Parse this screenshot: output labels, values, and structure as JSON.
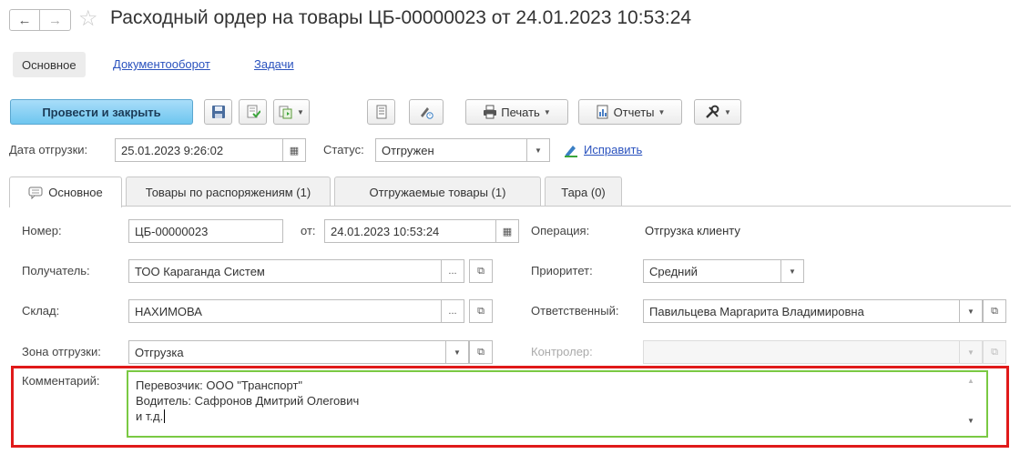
{
  "header": {
    "back_glyph": "←",
    "forward_glyph": "→",
    "star_glyph": "☆",
    "title": "Расходный ордер на товары ЦБ-00000023 от 24.01.2023 10:53:24"
  },
  "top_tabs": {
    "main": "Основное",
    "docflow": "Документооборот",
    "tasks": "Задачи"
  },
  "toolbar": {
    "post_close": "Провести и закрыть",
    "print": "Печать",
    "reports": "Отчеты",
    "caret": "▼"
  },
  "shipment": {
    "date_label": "Дата отгрузки:",
    "date_value": "25.01.2023  9:26:02",
    "status_label": "Статус:",
    "status_value": "Отгружен",
    "fix_link": "Исправить"
  },
  "inner_tabs": [
    {
      "label": "Основное"
    },
    {
      "label": "Товары по распоряжениям (1)"
    },
    {
      "label": "Отгружаемые товары (1)"
    },
    {
      "label": "Тара (0)"
    }
  ],
  "form": {
    "number_label": "Номер:",
    "number_value": "ЦБ-00000023",
    "from_label": "от:",
    "from_value": "24.01.2023 10:53:24",
    "operation_label": "Операция:",
    "operation_value": "Отгрузка клиенту",
    "recipient_label": "Получатель:",
    "recipient_value": "ТОО Караганда Систем",
    "priority_label": "Приоритет:",
    "priority_value": "Средний",
    "warehouse_label": "Склад:",
    "warehouse_value": "НАХИМОВА",
    "responsible_label": "Ответственный:",
    "responsible_value": "Павильцева Маргарита Владимировна",
    "zone_label": "Зона отгрузки:",
    "zone_value": "Отгрузка",
    "controller_label": "Контролер:",
    "controller_value": "",
    "comment_label": "Комментарий:",
    "comment_lines": [
      "Перевозчик: ООО \"Транспорт\"",
      "Водитель: Сафронов Дмитрий Олегович",
      "и т.д."
    ]
  },
  "glyphs": {
    "ellipsis": "...",
    "calendar": "▦",
    "open": "⧉",
    "dropdown": "▼",
    "scroll_up": "▲",
    "scroll_down": "▼"
  },
  "colors": {
    "primary_button": "#6ec6ef",
    "link": "#2a52be",
    "highlight_red": "#e01a1a",
    "comment_border_green": "#7ac943"
  }
}
